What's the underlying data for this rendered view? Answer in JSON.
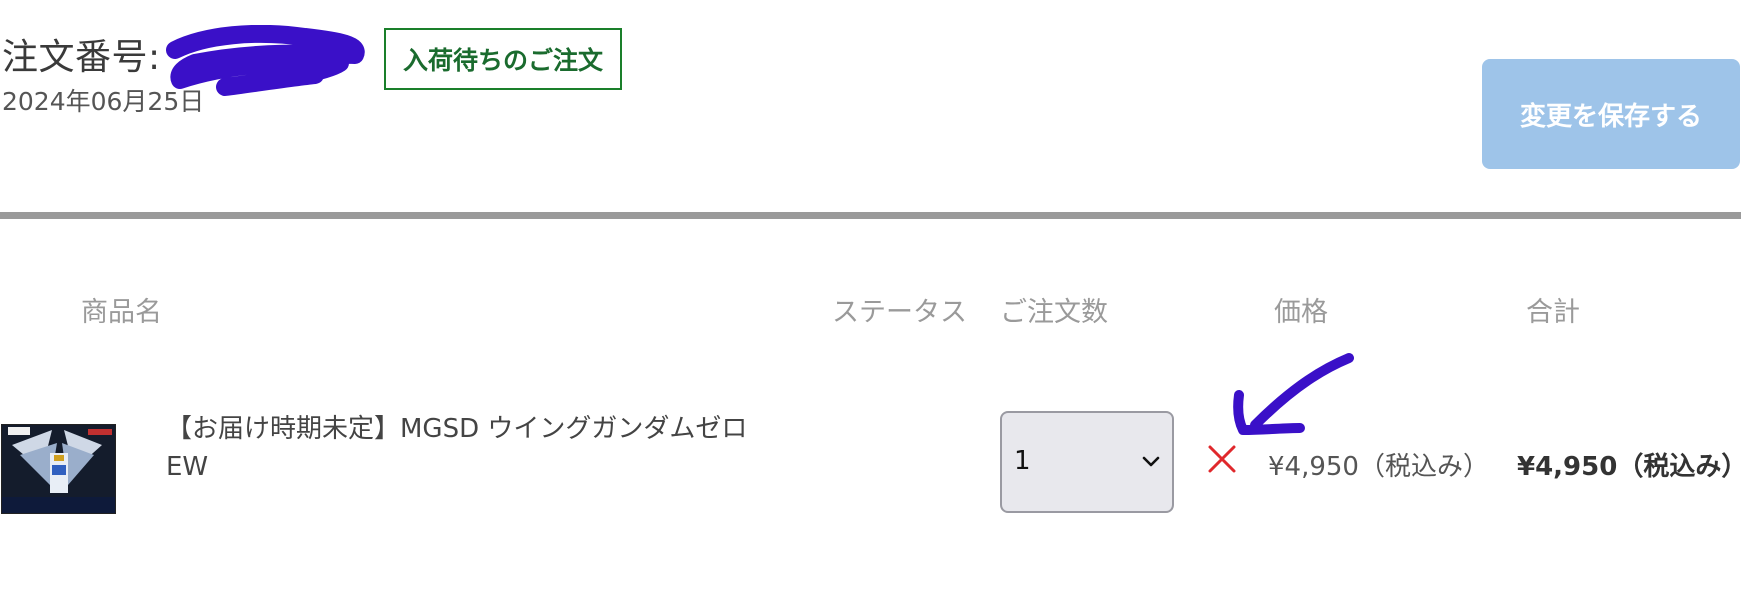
{
  "order": {
    "number_label": "注文番号:",
    "date": "2024年06月25日",
    "status_badge": "入荷待ちのご注文",
    "save_button_label": "変更を保存する"
  },
  "table": {
    "headers": [
      "商品名",
      "ステータス",
      "ご注文数",
      "価格",
      "合計"
    ],
    "rows": [
      {
        "product_name": "【お届け時期未定】MGSD ウイングガンダムゼロEW",
        "status": "",
        "quantity": "1",
        "unit_price": "¥4,950（税込み）",
        "total": "¥4,950（税込み）"
      }
    ]
  },
  "icons": {
    "remove": "close-x-icon",
    "quantity_dropdown": "chevron-down-icon"
  },
  "colors": {
    "status_badge": "#1a7f2a",
    "save_button_disabled": "#9ec4e9",
    "remove_icon": "#e0282c",
    "annotation_ink": "#3a10c8",
    "divider": "#9a9a9a"
  }
}
